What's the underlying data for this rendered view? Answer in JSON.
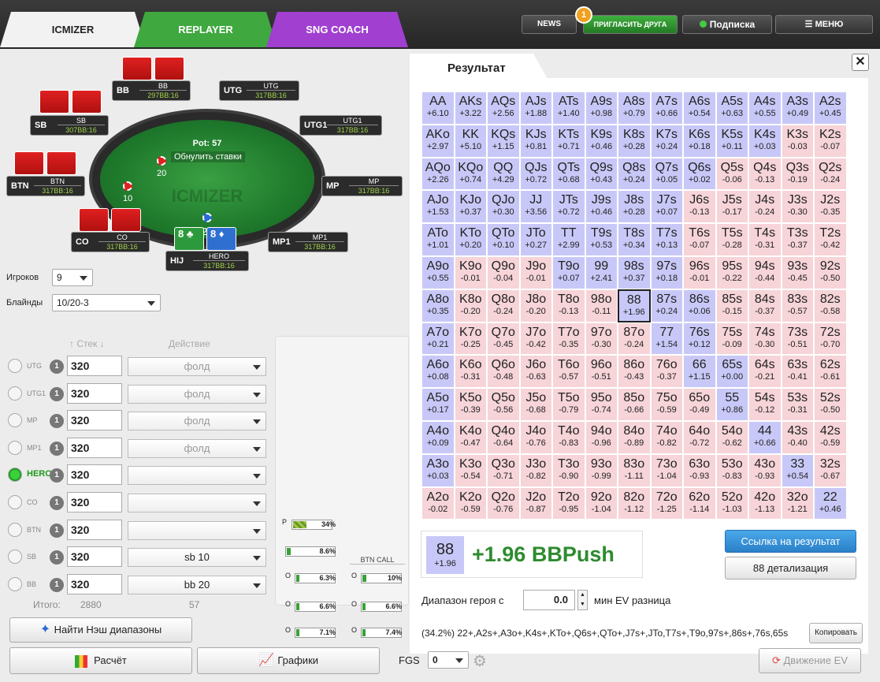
{
  "tabs": {
    "icmizer": "ICMIZER",
    "replayer": "REPLAYER",
    "sng": "SNG COACH"
  },
  "topbar": {
    "news": "NEWS",
    "invite": "ПРИГЛАСИТЬ ДРУГА",
    "invite_badge": "1",
    "subscribe": "Подписка",
    "menu": "МЕНЮ"
  },
  "table": {
    "pot": "Pot: 57",
    "reset": "Обнулить ставки",
    "watermark": "ICMIZER",
    "bet_bb": "20",
    "bet_sb": "10",
    "bet_hero": "27",
    "dealer": "D",
    "seats": [
      {
        "pos": "BB",
        "name": "BB",
        "stack": "297BB:16"
      },
      {
        "pos": "UTG",
        "name": "UTG",
        "stack": "317BB:16"
      },
      {
        "pos": "SB",
        "name": "SB",
        "stack": "307BB:16"
      },
      {
        "pos": "UTG1",
        "name": "UTG1",
        "stack": "317BB:16"
      },
      {
        "pos": "BTN",
        "name": "BTN",
        "stack": "317BB:16"
      },
      {
        "pos": "MP",
        "name": "MP",
        "stack": "317BB:16"
      },
      {
        "pos": "CO",
        "name": "CO",
        "stack": "317BB:16"
      },
      {
        "pos": "MP1",
        "name": "MP1",
        "stack": "317BB:16"
      },
      {
        "pos": "HIJ",
        "name": "HERO",
        "stack": "317BB:16"
      }
    ],
    "hero_cards": [
      "8",
      "8"
    ]
  },
  "controls": {
    "players_label": "Игроков",
    "players_value": "9",
    "blinds_label": "Блайнды",
    "blinds_value": "10/20-3",
    "stack_header": "Стек",
    "action_header": "Действие"
  },
  "players": [
    {
      "label": "UTG",
      "num": "1",
      "stack": "320",
      "action": "фолд"
    },
    {
      "label": "UTG1",
      "num": "1",
      "stack": "320",
      "action": "фолд"
    },
    {
      "label": "MP",
      "num": "1",
      "stack": "320",
      "action": "фолд"
    },
    {
      "label": "MP1",
      "num": "1",
      "stack": "320",
      "action": "фолд"
    },
    {
      "label": "HERO",
      "num": "1",
      "stack": "320",
      "action": ""
    },
    {
      "label": "CO",
      "num": "1",
      "stack": "320",
      "action": ""
    },
    {
      "label": "BTN",
      "num": "1",
      "stack": "320",
      "action": ""
    },
    {
      "label": "SB",
      "num": "1",
      "stack": "320",
      "action": "sb 10"
    },
    {
      "label": "BB",
      "num": "1",
      "stack": "320",
      "action": "bb 20"
    }
  ],
  "totals": {
    "label": "Итого:",
    "stack": "2880",
    "action": "57"
  },
  "stats": {
    "p_label": "P",
    "p_value": "34%",
    "p_fill": 0.34,
    "v1": "8.6%",
    "btn_call": "BTN CALL",
    "o1": "6.3%",
    "o1r": "10%",
    "o2": "6.6%",
    "o2r": "6.6%",
    "o3": "7.1%",
    "o3r": "7.4%",
    "o": "O"
  },
  "buttons": {
    "nash": "Найти Нэш диапазоны",
    "calc": "Расчёт",
    "graphs": "Графики",
    "fgs": "FGS",
    "fgs_value": "0",
    "ev_move": "Движение EV",
    "link": "Ссылка на результат",
    "detail": "88 детализация",
    "copy": "Копировать"
  },
  "result": {
    "title": "Результат",
    "close": "✕",
    "hero_range_label": "Диапазон героя с",
    "min_ev": "0.0",
    "min_ev_label": "мин EV разница",
    "range_text": "(34.2%) 22+,A2s+,A3o+,K4s+,KTo+,Q6s+,QTo+,J7s+,JTo,T7s+,T9o,97s+,86s+,76s,65s",
    "selected_hand": "88",
    "selected_ev": "+1.96",
    "selected_big": "+1.96 BBPush"
  },
  "matrix": [
    [
      [
        "AA",
        "+6.10",
        "p"
      ],
      [
        "AKs",
        "+3.22",
        "p"
      ],
      [
        "AQs",
        "+2.56",
        "p"
      ],
      [
        "AJs",
        "+1.88",
        "p"
      ],
      [
        "ATs",
        "+1.40",
        "p"
      ],
      [
        "A9s",
        "+0.98",
        "p"
      ],
      [
        "A8s",
        "+0.79",
        "p"
      ],
      [
        "A7s",
        "+0.66",
        "p"
      ],
      [
        "A6s",
        "+0.54",
        "p"
      ],
      [
        "A5s",
        "+0.63",
        "p"
      ],
      [
        "A4s",
        "+0.55",
        "p"
      ],
      [
        "A3s",
        "+0.49",
        "p"
      ],
      [
        "A2s",
        "+0.45",
        "p"
      ]
    ],
    [
      [
        "AKo",
        "+2.97",
        "p"
      ],
      [
        "KK",
        "+5.10",
        "p"
      ],
      [
        "KQs",
        "+1.15",
        "p"
      ],
      [
        "KJs",
        "+0.81",
        "p"
      ],
      [
        "KTs",
        "+0.71",
        "p"
      ],
      [
        "K9s",
        "+0.46",
        "p"
      ],
      [
        "K8s",
        "+0.28",
        "p"
      ],
      [
        "K7s",
        "+0.24",
        "p"
      ],
      [
        "K6s",
        "+0.18",
        "p"
      ],
      [
        "K5s",
        "+0.11",
        "p"
      ],
      [
        "K4s",
        "+0.03",
        "p"
      ],
      [
        "K3s",
        "-0.03",
        "f"
      ],
      [
        "K2s",
        "-0.07",
        "f"
      ]
    ],
    [
      [
        "AQo",
        "+2.26",
        "p"
      ],
      [
        "KQo",
        "+0.74",
        "p"
      ],
      [
        "QQ",
        "+4.29",
        "p"
      ],
      [
        "QJs",
        "+0.72",
        "p"
      ],
      [
        "QTs",
        "+0.68",
        "p"
      ],
      [
        "Q9s",
        "+0.43",
        "p"
      ],
      [
        "Q8s",
        "+0.24",
        "p"
      ],
      [
        "Q7s",
        "+0.05",
        "p"
      ],
      [
        "Q6s",
        "+0.02",
        "p"
      ],
      [
        "Q5s",
        "-0.06",
        "f"
      ],
      [
        "Q4s",
        "-0.13",
        "f"
      ],
      [
        "Q3s",
        "-0.19",
        "f"
      ],
      [
        "Q2s",
        "-0.24",
        "f"
      ]
    ],
    [
      [
        "AJo",
        "+1.53",
        "p"
      ],
      [
        "KJo",
        "+0.37",
        "p"
      ],
      [
        "QJo",
        "+0.30",
        "p"
      ],
      [
        "JJ",
        "+3.56",
        "p"
      ],
      [
        "JTs",
        "+0.72",
        "p"
      ],
      [
        "J9s",
        "+0.46",
        "p"
      ],
      [
        "J8s",
        "+0.28",
        "p"
      ],
      [
        "J7s",
        "+0.07",
        "p"
      ],
      [
        "J6s",
        "-0.13",
        "f"
      ],
      [
        "J5s",
        "-0.17",
        "f"
      ],
      [
        "J4s",
        "-0.24",
        "f"
      ],
      [
        "J3s",
        "-0.30",
        "f"
      ],
      [
        "J2s",
        "-0.35",
        "f"
      ]
    ],
    [
      [
        "ATo",
        "+1.01",
        "p"
      ],
      [
        "KTo",
        "+0.20",
        "p"
      ],
      [
        "QTo",
        "+0.10",
        "p"
      ],
      [
        "JTo",
        "+0.27",
        "p"
      ],
      [
        "TT",
        "+2.99",
        "p"
      ],
      [
        "T9s",
        "+0.53",
        "p"
      ],
      [
        "T8s",
        "+0.34",
        "p"
      ],
      [
        "T7s",
        "+0.13",
        "p"
      ],
      [
        "T6s",
        "-0.07",
        "f"
      ],
      [
        "T5s",
        "-0.28",
        "f"
      ],
      [
        "T4s",
        "-0.31",
        "f"
      ],
      [
        "T3s",
        "-0.37",
        "f"
      ],
      [
        "T2s",
        "-0.42",
        "f"
      ]
    ],
    [
      [
        "A9o",
        "+0.55",
        "p"
      ],
      [
        "K9o",
        "-0.01",
        "f"
      ],
      [
        "Q9o",
        "-0.04",
        "f"
      ],
      [
        "J9o",
        "-0.01",
        "f"
      ],
      [
        "T9o",
        "+0.07",
        "p"
      ],
      [
        "99",
        "+2.41",
        "p"
      ],
      [
        "98s",
        "+0.37",
        "p"
      ],
      [
        "97s",
        "+0.18",
        "p"
      ],
      [
        "96s",
        "-0.01",
        "f"
      ],
      [
        "95s",
        "-0.22",
        "f"
      ],
      [
        "94s",
        "-0.44",
        "f"
      ],
      [
        "93s",
        "-0.45",
        "f"
      ],
      [
        "92s",
        "-0.50",
        "f"
      ]
    ],
    [
      [
        "A8o",
        "+0.35",
        "p"
      ],
      [
        "K8o",
        "-0.20",
        "f"
      ],
      [
        "Q8o",
        "-0.24",
        "f"
      ],
      [
        "J8o",
        "-0.20",
        "f"
      ],
      [
        "T8o",
        "-0.13",
        "f"
      ],
      [
        "98o",
        "-0.11",
        "f"
      ],
      [
        "88",
        "+1.96",
        "s"
      ],
      [
        "87s",
        "+0.24",
        "p"
      ],
      [
        "86s",
        "+0.06",
        "p"
      ],
      [
        "85s",
        "-0.15",
        "f"
      ],
      [
        "84s",
        "-0.37",
        "f"
      ],
      [
        "83s",
        "-0.57",
        "f"
      ],
      [
        "82s",
        "-0.58",
        "f"
      ]
    ],
    [
      [
        "A7o",
        "+0.21",
        "p"
      ],
      [
        "K7o",
        "-0.25",
        "f"
      ],
      [
        "Q7o",
        "-0.45",
        "f"
      ],
      [
        "J7o",
        "-0.42",
        "f"
      ],
      [
        "T7o",
        "-0.35",
        "f"
      ],
      [
        "97o",
        "-0.30",
        "f"
      ],
      [
        "87o",
        "-0.24",
        "f"
      ],
      [
        "77",
        "+1.54",
        "p"
      ],
      [
        "76s",
        "+0.12",
        "p"
      ],
      [
        "75s",
        "-0.09",
        "f"
      ],
      [
        "74s",
        "-0.30",
        "f"
      ],
      [
        "73s",
        "-0.51",
        "f"
      ],
      [
        "72s",
        "-0.70",
        "f"
      ]
    ],
    [
      [
        "A6o",
        "+0.08",
        "p"
      ],
      [
        "K6o",
        "-0.31",
        "f"
      ],
      [
        "Q6o",
        "-0.48",
        "f"
      ],
      [
        "J6o",
        "-0.63",
        "f"
      ],
      [
        "T6o",
        "-0.57",
        "f"
      ],
      [
        "96o",
        "-0.51",
        "f"
      ],
      [
        "86o",
        "-0.43",
        "f"
      ],
      [
        "76o",
        "-0.37",
        "f"
      ],
      [
        "66",
        "+1.15",
        "p"
      ],
      [
        "65s",
        "+0.00",
        "p"
      ],
      [
        "64s",
        "-0.21",
        "f"
      ],
      [
        "63s",
        "-0.41",
        "f"
      ],
      [
        "62s",
        "-0.61",
        "f"
      ]
    ],
    [
      [
        "A5o",
        "+0.17",
        "p"
      ],
      [
        "K5o",
        "-0.39",
        "f"
      ],
      [
        "Q5o",
        "-0.56",
        "f"
      ],
      [
        "J5o",
        "-0.68",
        "f"
      ],
      [
        "T5o",
        "-0.79",
        "f"
      ],
      [
        "95o",
        "-0.74",
        "f"
      ],
      [
        "85o",
        "-0.66",
        "f"
      ],
      [
        "75o",
        "-0.59",
        "f"
      ],
      [
        "65o",
        "-0.49",
        "f"
      ],
      [
        "55",
        "+0.86",
        "p"
      ],
      [
        "54s",
        "-0.12",
        "f"
      ],
      [
        "53s",
        "-0.31",
        "f"
      ],
      [
        "52s",
        "-0.50",
        "f"
      ]
    ],
    [
      [
        "A4o",
        "+0.09",
        "p"
      ],
      [
        "K4o",
        "-0.47",
        "f"
      ],
      [
        "Q4o",
        "-0.64",
        "f"
      ],
      [
        "J4o",
        "-0.76",
        "f"
      ],
      [
        "T4o",
        "-0.83",
        "f"
      ],
      [
        "94o",
        "-0.96",
        "f"
      ],
      [
        "84o",
        "-0.89",
        "f"
      ],
      [
        "74o",
        "-0.82",
        "f"
      ],
      [
        "64o",
        "-0.72",
        "f"
      ],
      [
        "54o",
        "-0.62",
        "f"
      ],
      [
        "44",
        "+0.66",
        "p"
      ],
      [
        "43s",
        "-0.40",
        "f"
      ],
      [
        "42s",
        "-0.59",
        "f"
      ]
    ],
    [
      [
        "A3o",
        "+0.03",
        "p"
      ],
      [
        "K3o",
        "-0.54",
        "f"
      ],
      [
        "Q3o",
        "-0.71",
        "f"
      ],
      [
        "J3o",
        "-0.82",
        "f"
      ],
      [
        "T3o",
        "-0.90",
        "f"
      ],
      [
        "93o",
        "-0.99",
        "f"
      ],
      [
        "83o",
        "-1.11",
        "f"
      ],
      [
        "73o",
        "-1.04",
        "f"
      ],
      [
        "63o",
        "-0.93",
        "f"
      ],
      [
        "53o",
        "-0.83",
        "f"
      ],
      [
        "43o",
        "-0.93",
        "f"
      ],
      [
        "33",
        "+0.54",
        "p"
      ],
      [
        "32s",
        "-0.67",
        "f"
      ]
    ],
    [
      [
        "A2o",
        "-0.02",
        "f"
      ],
      [
        "K2o",
        "-0.59",
        "f"
      ],
      [
        "Q2o",
        "-0.76",
        "f"
      ],
      [
        "J2o",
        "-0.87",
        "f"
      ],
      [
        "T2o",
        "-0.95",
        "f"
      ],
      [
        "92o",
        "-1.04",
        "f"
      ],
      [
        "82o",
        "-1.12",
        "f"
      ],
      [
        "72o",
        "-1.25",
        "f"
      ],
      [
        "62o",
        "-1.14",
        "f"
      ],
      [
        "52o",
        "-1.03",
        "f"
      ],
      [
        "42o",
        "-1.13",
        "f"
      ],
      [
        "32o",
        "-1.21",
        "f"
      ],
      [
        "22",
        "+0.46",
        "p"
      ]
    ]
  ]
}
